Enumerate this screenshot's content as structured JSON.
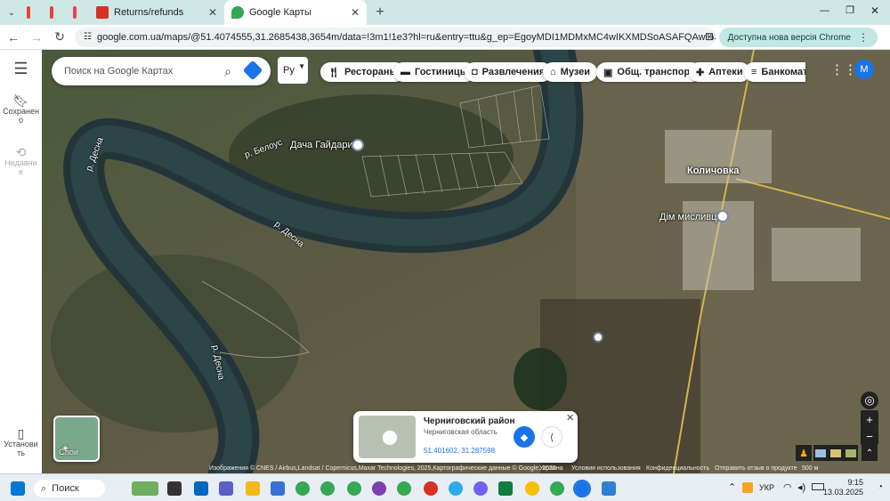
{
  "browser": {
    "tabs": [
      {
        "label": "Returns/refunds",
        "favicon_color": "#d93025"
      },
      {
        "label": "Google Карты",
        "favicon_color": "#34a853",
        "active": true
      }
    ],
    "url": "google.com.ua/maps/@51.4074555,31.2685438,3654m/data=!3m1!1e3?hl=ru&entry=ttu&g_ep=EgoyMDI1MDMxMC4wIKXMDSoASAFQAw%3D%3D",
    "update_button": "Доступна нова версія Chrome",
    "profile_initial": "M"
  },
  "left_rail": {
    "saved_label": "Сохранено",
    "recent_label": "Недавние",
    "install_label": "Установить"
  },
  "search": {
    "placeholder": "Поиск на Google Картах",
    "lang_value": "Ру"
  },
  "chips": [
    {
      "label": "Рестораны",
      "icon": "fork-knife-icon"
    },
    {
      "label": "Гостиницы",
      "icon": "bed-icon"
    },
    {
      "label": "Развлечения",
      "icon": "camera-icon"
    },
    {
      "label": "Музеи",
      "icon": "museum-icon"
    },
    {
      "label": "Общ. транспорт",
      "icon": "bus-icon"
    },
    {
      "label": "Аптеки",
      "icon": "pharmacy-icon"
    },
    {
      "label": "Банкоматы",
      "icon": "atm-icon"
    }
  ],
  "account_initial": "M",
  "map_labels": {
    "place_dacha": "Дача Гайдарин",
    "river_belous": "р. Белоус",
    "river_desna_1": "р. Десна",
    "river_desna_2": "р. Десна",
    "river_desna_3": "р. Десна",
    "town": "Количовка",
    "hunter_house": "Дім мисливця"
  },
  "info_card": {
    "title": "Черниговский район",
    "subtitle": "Черниговская область",
    "coords": "51.401602, 31.287598"
  },
  "layers_label": "Слои",
  "attribution": {
    "imagery": "Изображения © CNES / Airbus,Landsat / Copernicus,Maxar Technologies, 2025,Картографические данные © Google, 2025",
    "country": "Украина",
    "terms": "Условия использования",
    "privacy": "Конфиденциальность",
    "feedback": "Отправить отзыв о продукте",
    "scale": "500 м"
  },
  "taskbar": {
    "search_label": "Поиск",
    "lang": "УКР",
    "time": "9:15",
    "date": "13.03.2025"
  }
}
